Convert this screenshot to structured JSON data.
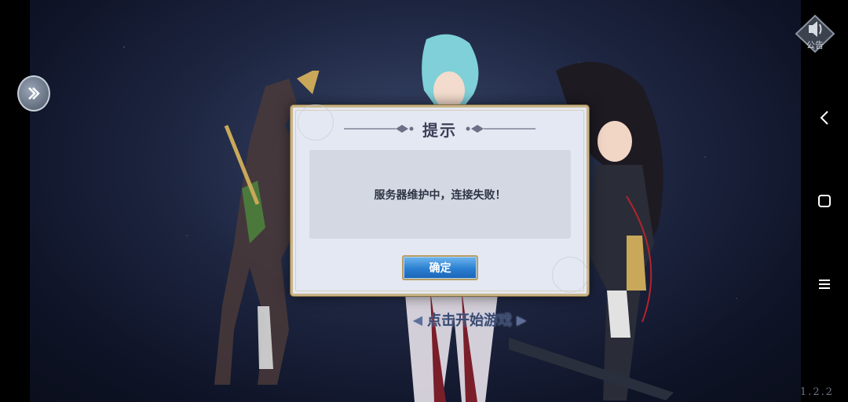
{
  "dialog": {
    "title": "提示",
    "message": "服务器维护中，连接失败！",
    "confirm_label": "确定"
  },
  "start_hint": "点击开始游戏",
  "notice": {
    "label": "公告",
    "icon": "speaker-icon"
  },
  "version": "1.2.2",
  "icons": {
    "side_arrow": "double-chevron-right-icon",
    "back": "back-icon",
    "home": "home-icon",
    "menu": "menu-icon"
  },
  "colors": {
    "dialog_bg": "#e4e8f2",
    "dialog_border": "#c9b486",
    "button_blue": "#2a7fd1",
    "background": "#1d2540"
  }
}
